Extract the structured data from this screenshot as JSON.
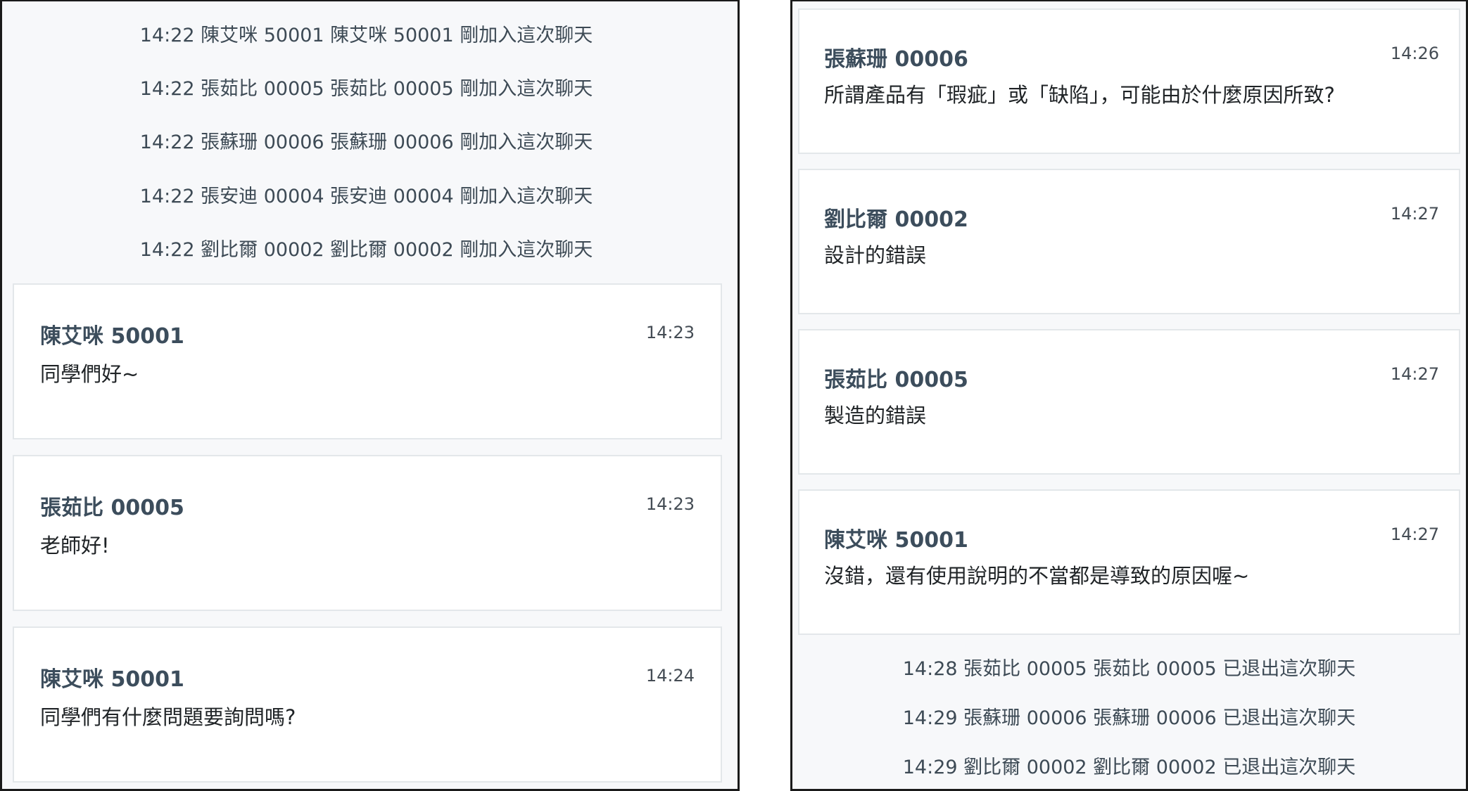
{
  "left": {
    "system": [
      "14:22 陳艾咪 50001 陳艾咪 50001 剛加入這次聊天",
      "14:22 張茹比 00005 張茹比 00005 剛加入這次聊天",
      "14:22 張蘇珊 00006 張蘇珊 00006 剛加入這次聊天",
      "14:22 張安迪 00004 張安迪 00004 剛加入這次聊天",
      "14:22 劉比爾 00002 劉比爾 00002 剛加入這次聊天"
    ],
    "messages": [
      {
        "sender": "陳艾咪 50001",
        "time": "14:23",
        "text": "同學們好~"
      },
      {
        "sender": "張茹比 00005",
        "time": "14:23",
        "text": "老師好!"
      },
      {
        "sender": "陳艾咪 50001",
        "time": "14:24",
        "text": "同學們有什麼問題要詢問嗎?"
      }
    ]
  },
  "right": {
    "messages": [
      {
        "sender": "張蘇珊 00006",
        "time": "14:26",
        "text": "所謂產品有「瑕疵」或「缺陷」，可能由於什麼原因所致?"
      },
      {
        "sender": "劉比爾 00002",
        "time": "14:27",
        "text": "設計的錯誤"
      },
      {
        "sender": "張茹比 00005",
        "time": "14:27",
        "text": "製造的錯誤"
      },
      {
        "sender": "陳艾咪 50001",
        "time": "14:27",
        "text": "沒錯，還有使用說明的不當都是導致的原因喔~"
      }
    ],
    "system": [
      "14:28 張茹比 00005 張茹比 00005 已退出這次聊天",
      "14:29 張蘇珊 00006 張蘇珊 00006 已退出這次聊天",
      "14:29 劉比爾 00002 劉比爾 00002 已退出這次聊天"
    ]
  }
}
